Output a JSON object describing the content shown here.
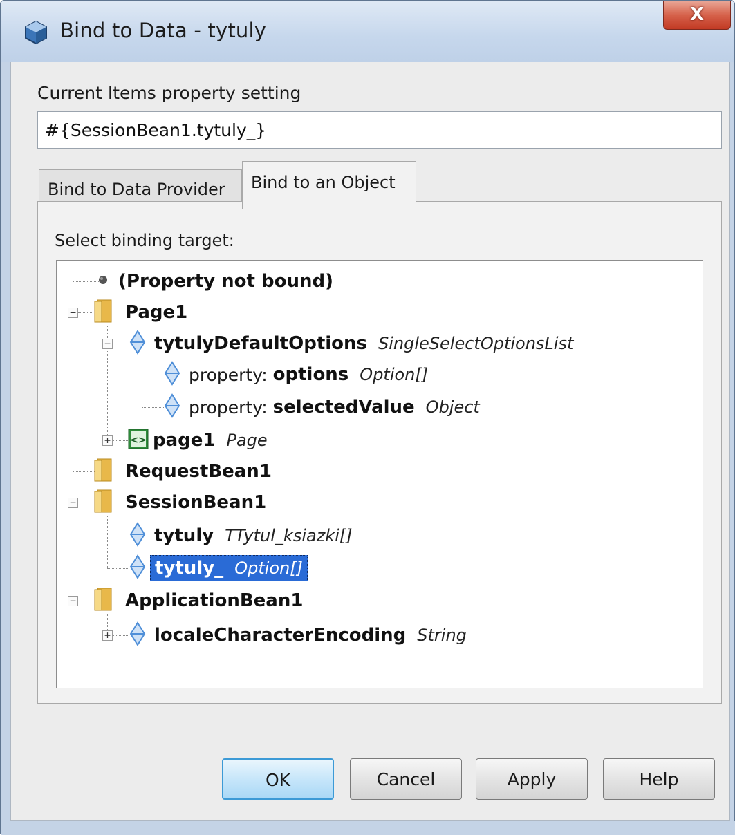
{
  "window": {
    "title": "Bind to Data - tytuly",
    "close_label": "X"
  },
  "current": {
    "label": "Current Items property setting",
    "value": "#{SessionBean1.tytuly_}"
  },
  "tabs": [
    {
      "label": "Bind to Data Provider",
      "active": false
    },
    {
      "label": "Bind to an Object",
      "active": true
    }
  ],
  "tree": {
    "label": "Select binding target:",
    "rows": [
      {
        "name": "(Property not bound)",
        "type": "",
        "icon": "dot-icon"
      },
      {
        "name": "Page1",
        "type": "",
        "icon": "folder-icon"
      },
      {
        "name": "tytulyDefaultOptions",
        "type": "SingleSelectOptionsList",
        "icon": "bean-property-icon"
      },
      {
        "prefix": "property:",
        "name": "options",
        "type": "Option[]",
        "icon": "bean-property-icon"
      },
      {
        "prefix": "property:",
        "name": "selectedValue",
        "type": "Object",
        "icon": "bean-property-icon"
      },
      {
        "name": "page1",
        "type": "Page",
        "icon": "page-tag-icon"
      },
      {
        "name": "RequestBean1",
        "type": "",
        "icon": "folder-icon"
      },
      {
        "name": "SessionBean1",
        "type": "",
        "icon": "folder-icon"
      },
      {
        "name": "tytuly",
        "type": "TTytul_ksiazki[]",
        "icon": "bean-property-icon"
      },
      {
        "name": "tytuly_",
        "type": "Option[]",
        "icon": "bean-property-icon",
        "selected": true
      },
      {
        "name": "ApplicationBean1",
        "type": "",
        "icon": "folder-icon"
      },
      {
        "name": "localeCharacterEncoding",
        "type": "String",
        "icon": "bean-property-icon"
      }
    ]
  },
  "buttons": {
    "ok": "OK",
    "cancel": "Cancel",
    "apply": "Apply",
    "help": "Help"
  },
  "colors": {
    "selection": "#2a6bd6",
    "folder": "#e8b84a",
    "property_icon": "#4f8fd8",
    "frame": "#c4d3e6"
  }
}
